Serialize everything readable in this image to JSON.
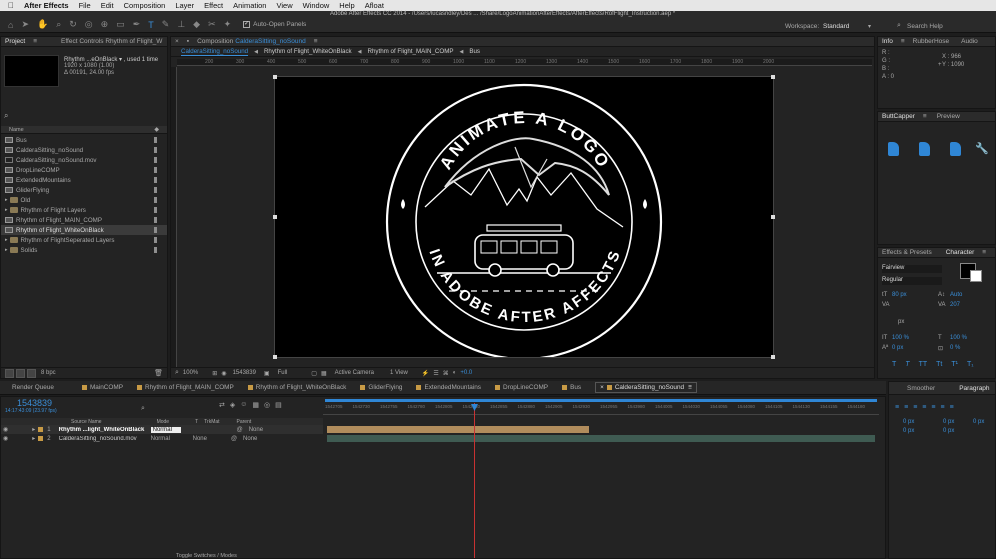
{
  "menubar": {
    "app": "After Effects",
    "items": [
      "File",
      "Edit",
      "Composition",
      "Layer",
      "Effect",
      "Animation",
      "View",
      "Window",
      "Help",
      "Afloat"
    ]
  },
  "title": "Adobe After Effects CC 2014 - /Users/lucasridley/Des ... /Share/LogoAnimationAfterEffects/AfterEffects/RofFlight_Instruction.aep *",
  "toolbar": {
    "auto_open": "Auto-Open Panels",
    "workspace_label": "Workspace:",
    "workspace_value": "Standard",
    "search_help": "Search Help"
  },
  "project": {
    "tab": "Project",
    "tab2": "Effect Controls Rhythm of Flight_W",
    "preview_name": "Rhythm ...eOnBlack ▾ , used 1 time",
    "preview_dims": "1920 x 1080 (1.00)",
    "preview_dur": "Δ 00191, 24.00 fps",
    "col_name": "Name",
    "bpc": "8 bpc",
    "items": [
      {
        "name": "Bus",
        "kind": "comp"
      },
      {
        "name": "CalderaSitting_noSound",
        "kind": "comp"
      },
      {
        "name": "CalderaSitting_noSound.mov",
        "kind": "file"
      },
      {
        "name": "DropLineCOMP",
        "kind": "comp"
      },
      {
        "name": "ExtendedMountains",
        "kind": "comp"
      },
      {
        "name": "GliderFlying",
        "kind": "comp"
      },
      {
        "name": "Old",
        "kind": "folder"
      },
      {
        "name": "Rhythm of Flight Layers",
        "kind": "folder"
      },
      {
        "name": "Rhythm of Flight_MAIN_COMP",
        "kind": "comp"
      },
      {
        "name": "Rhythm of Flight_WhiteOnBlack",
        "kind": "comp",
        "selected": true
      },
      {
        "name": "Rhythm of FlightSeperated Layers",
        "kind": "folder"
      },
      {
        "name": "Solids",
        "kind": "folder"
      }
    ]
  },
  "composition": {
    "tab_prefix": "Composition",
    "tab_name": "CalderaSitting_noSound",
    "breadcrumbs": [
      "CalderaSitting_noSound",
      "Rhythm of Flight_WhiteOnBlack",
      "Rhythm of Flight_MAIN_COMP",
      "Bus"
    ],
    "ruler": [
      "200",
      "300",
      "400",
      "500",
      "600",
      "700",
      "800",
      "900",
      "1000",
      "1100",
      "1200",
      "1300",
      "1400",
      "1500",
      "1600",
      "1700",
      "1800",
      "1900",
      "2000"
    ],
    "logo_top": "ANIMATE A LOGO",
    "logo_bottom": "IN ADOBE AFTER AFFECTS",
    "footer": {
      "zoom": "100%",
      "timecode": "1543839",
      "resolution": "Full",
      "camera": "Active Camera",
      "view": "1 View",
      "exposure": "+0.0"
    }
  },
  "info": {
    "tab": "Info",
    "tab2": "RubberHose",
    "tab3": "Audio",
    "r": "R :",
    "g": "G :",
    "b": "B :",
    "a": "A : 0",
    "x": "X : 966",
    "y": "Y : 1090"
  },
  "buttcapper": {
    "tab": "ButtCapper",
    "tab2": "Preview"
  },
  "character": {
    "tab1": "Effects & Presets",
    "tab2": "Character",
    "font": "Fairview",
    "style": "Regular",
    "size": "80 px",
    "leading": "Auto",
    "kerning": "",
    "tracking": "207",
    "line_units": "px",
    "vscale": "100 %",
    "hscale": "100 %",
    "baseline": "0 px",
    "tsume": "0 %",
    "styles": [
      "T",
      "T",
      "TT",
      "Tt",
      "T¹",
      "T₁"
    ]
  },
  "bottom_tabs": [
    "Render Queue",
    "MainCOMP",
    "Rhythm of Flight_MAIN_COMP",
    "Rhythm of Flight_WhiteOnBlack",
    "GliderFlying",
    "ExtendedMountains",
    "DropLineCOMP",
    "Bus",
    "CalderaSitting_noSound"
  ],
  "timeline": {
    "timecode": "1543839",
    "subcode": "14:17:43:09 (23.97 fps)",
    "columns": {
      "source": "Source Name",
      "mode": "Mode",
      "t": "T",
      "trkmat": "TrkMat",
      "parent": "Parent"
    },
    "layers": [
      {
        "num": "1",
        "name": "Rhythm ...light_WhiteOnBlack",
        "mode": "Normal",
        "trkmat": "",
        "parent": "None"
      },
      {
        "num": "2",
        "name": "CalderaSitting_noSound.mov",
        "mode": "Normal",
        "trkmat": "None",
        "parent": "None"
      }
    ],
    "ruler": [
      "1542705",
      "1542730",
      "1542755",
      "1542780",
      "1542805",
      "1542830",
      "1542855",
      "1542880",
      "1542905",
      "1542930",
      "1542955",
      "1543980",
      "1544005",
      "1544030",
      "1544055",
      "1544080",
      "1544105",
      "1544130",
      "1544155",
      "1544180"
    ],
    "toggle": "Toggle Switches / Modes"
  },
  "smoother": {
    "tab": "Smoother",
    "tab2": "Paragraph",
    "indent1": "0 px",
    "indent2": "0 px",
    "indent3": "0 px",
    "space1": "0 px",
    "space2": "0 px"
  },
  "colors": {
    "accent": "#3a8fd9",
    "panel": "#232323",
    "bar_layer1": "#b08c5c",
    "bar_layer2": "#3f5b52",
    "playhead": "#c83232"
  }
}
